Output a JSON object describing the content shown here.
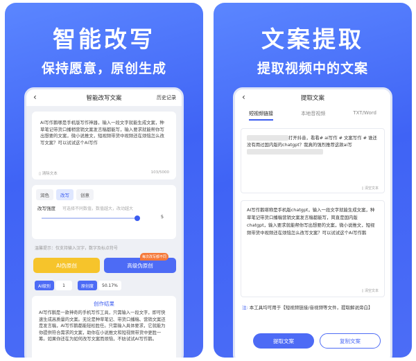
{
  "left": {
    "headline": "智能改写",
    "subline": "保持愿意，原创生成",
    "screen": {
      "title": "智能改写文案",
      "history": "历史记录",
      "input_text": "AI写作鹅哪是手机版写作神器，输入一段文字就能生成文案，种草笔记带货口播稍营销文案发言稿都能写，输入要求就能帮你写出想要的文案，微小说推文，短视频带货中视频还在烦恼怎么改写文案？可以试试这个AI写作",
      "clear_label": "清除文本",
      "count": "103/5000",
      "tabs": [
        "润色",
        "改写",
        "创意"
      ],
      "active_tab": "改写",
      "strength_label": "改写强度",
      "strength_hint": "可选择不同数值，数值越大，改动越大",
      "strength_value": "5",
      "tip": "温馨提示：仅支持输入汉字，数字及标点符号",
      "btn_ai": "AI伪原创",
      "btn_high": "高级伪原创",
      "badge": "每次改写都不同",
      "ai_level_label": "AI级别",
      "ai_level_value": "1",
      "originality_label": "原创度",
      "originality_value": "50.17%",
      "result_title": "创作结果",
      "result_text": "AI写作鹅是一款神奇的手机写作工具，只需输入一段文字，即可快速生成高质量的文案。无论是种草笔记、带货口播稿、营销文案还是发言稿，AI写作鹅都能轻松胜任。只需输入具体要求，它就能为你提供符合需求的文案，助你在小说推文和短视频带货中更胜一筹。如果你还在为如何改写文案而烦恼，不妨试试AI写作鹅。"
    }
  },
  "right": {
    "headline": "文案提取",
    "subline": "提取视频中的文案",
    "screen": {
      "title": "提取文案",
      "tabs": [
        "短视频链接",
        "本地音视频",
        "TXT/Word"
      ],
      "active_tab": "短视频链接",
      "link_text_a": "打开抖音，看看# ai写作",
      "link_text_b": "# 文案写作 # 谁还没有用过国内版的chatgpt？我真的强烈推荐这款ai写",
      "clear_label": "清空文本",
      "extract_text": "AI写作鹅堪称是手机版chatgpt，输入一段文字就能生成文案，种草笔记带货口播稿营销文案发言稿都能写，简直是国内版chatgpt，输入要求就能帮你写出想要的文案，微小说推文，短视频带货中视频还在烦恼怎么改写文案？可以试试这个Ai写作鹅",
      "clear_label2": "清空文本",
      "note_prefix": "注:",
      "note_text": "本工具均可用于【短视频链接/音视频等文件，提取解说旁白】",
      "btn_extract": "提取文案",
      "btn_copy": "复制文案"
    }
  },
  "colors": {
    "accent": "#4d6bf5",
    "panel": "#4a6cf6",
    "yellow": "#f6c42b"
  }
}
